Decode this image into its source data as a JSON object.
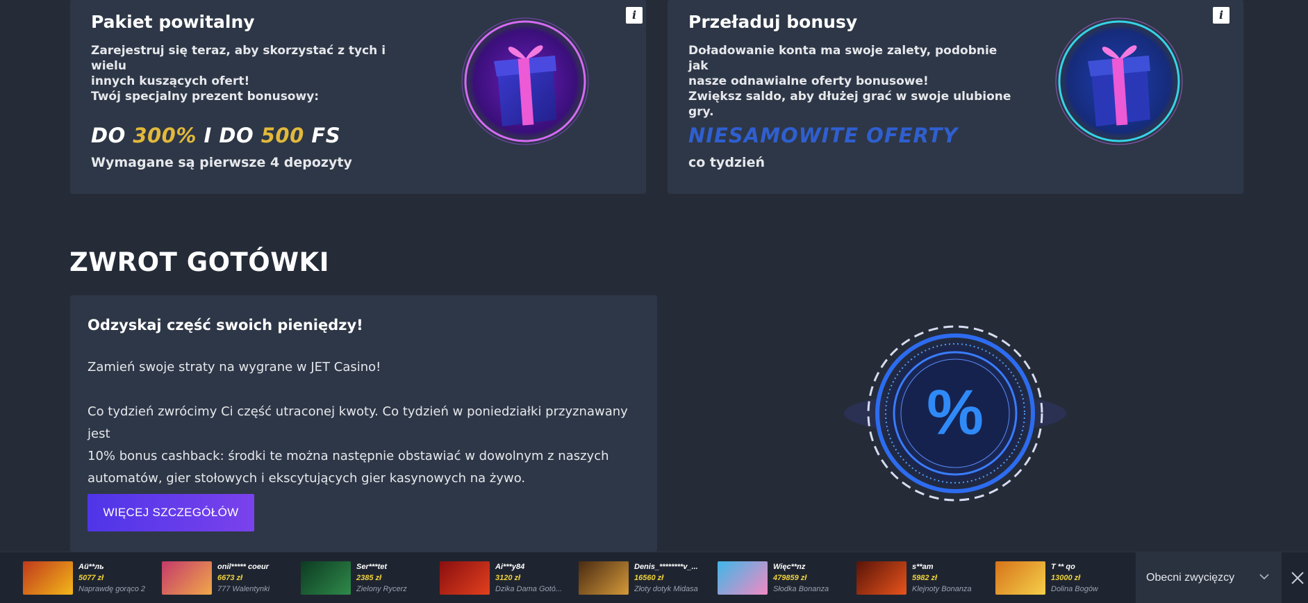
{
  "welcome": {
    "title": "Pakiet powitalny",
    "desc_line1": "Zarejestruj się teraz, aby skorzystać z tych i wielu",
    "desc_line2": "innych kuszących ofert!",
    "desc_line3": "Twój specjalny prezent bonusowy:",
    "offer_do1": "DO ",
    "offer_pct": "300%",
    "offer_mid": " I DO ",
    "offer_fs_num": "500",
    "offer_fs": " FS",
    "sub": "Wymagane są pierwsze 4 depozyty"
  },
  "reload": {
    "title": "Przeładuj bonusy",
    "desc_line1": "Doładowanie konta ma swoje zalety, podobnie jak",
    "desc_line2": "nasze odnawialne oferty bonusowe!",
    "desc_line3": "Zwiększ saldo, aby dłużej grać w swoje ulubione",
    "desc_line4": "gry.",
    "offer": "NIESAMOWITE OFERTY",
    "sub": "co tydzień"
  },
  "info_label": "i",
  "cashback": {
    "section_title": "ZWROT GOTÓWKI",
    "heading": "Odzyskaj część swoich pieniędzy!",
    "para1": "Zamień swoje straty na wygrane w JET Casino!",
    "para2_line1": "Co tydzień zwrócimy Ci część utraconej kwoty. Co tydzień w poniedziałki przyznawany jest",
    "para2_line2": "10% bonus cashback: środki te można następnie obstawiać w dowolnym z naszych",
    "para2_line3": "automatów, gier stołowych i ekscytujących gier kasynowych na żywo.",
    "button": "WIĘCEJ SZCZEGÓŁÓW",
    "percent_symbol": "%"
  },
  "ticker": {
    "winners": [
      {
        "name": "Aü**ль",
        "amount": "5077 zł",
        "game": "Naprawdę gorąco 2",
        "thumb_a": "#c0391b",
        "thumb_b": "#f3b81a",
        "icon": "hot-slot-icon"
      },
      {
        "name": "onil***** coeur",
        "amount": "6673 zł",
        "game": "777 Walentynki",
        "thumb_a": "#c43a6a",
        "thumb_b": "#f0a84a",
        "icon": "valentine-slot-icon"
      },
      {
        "name": "Ser***tet",
        "amount": "2385 zł",
        "game": "Zielony Rycerz",
        "thumb_a": "#0d3b22",
        "thumb_b": "#2f8a4a",
        "icon": "knight-slot-icon"
      },
      {
        "name": "Ai***y84",
        "amount": "3120 zł",
        "game": "Dzika Dama Gotó...",
        "thumb_a": "#8a0f0f",
        "thumb_b": "#e2401e",
        "icon": "wild-lady-slot-icon"
      },
      {
        "name": "Denis_********v_...",
        "amount": "16560 zł",
        "game": "Złoty dotyk Midasa",
        "thumb_a": "#4a2a12",
        "thumb_b": "#d49a3a",
        "icon": "midas-slot-icon"
      },
      {
        "name": "Więc**nz",
        "amount": "479859 zł",
        "game": "Słodka Bonanza",
        "thumb_a": "#3fb6e8",
        "thumb_b": "#f28ac2",
        "icon": "sweet-bonanza-icon"
      },
      {
        "name": "s**am",
        "amount": "5982 zł",
        "game": "Klejnoty Bonanza",
        "thumb_a": "#5a1408",
        "thumb_b": "#e8541c",
        "icon": "gems-bonanza-icon"
      },
      {
        "name": "T ** qo",
        "amount": "13000 zł",
        "game": "Dolina Bogów",
        "thumb_a": "#d6731a",
        "thumb_b": "#f5d04a",
        "icon": "valley-gods-icon"
      }
    ],
    "select_label": "Obecni zwycięzcy",
    "select_icon": "chevron-down-icon",
    "close_icon": "close-icon"
  },
  "colors": {
    "background": "#252c38",
    "card": "#2e3747",
    "gold": "#e2b93b",
    "offer_blue": "#2f5fd0",
    "button_start": "#4f35e8",
    "button_end": "#7a42ec",
    "amount_yellow": "#f0d23c"
  }
}
